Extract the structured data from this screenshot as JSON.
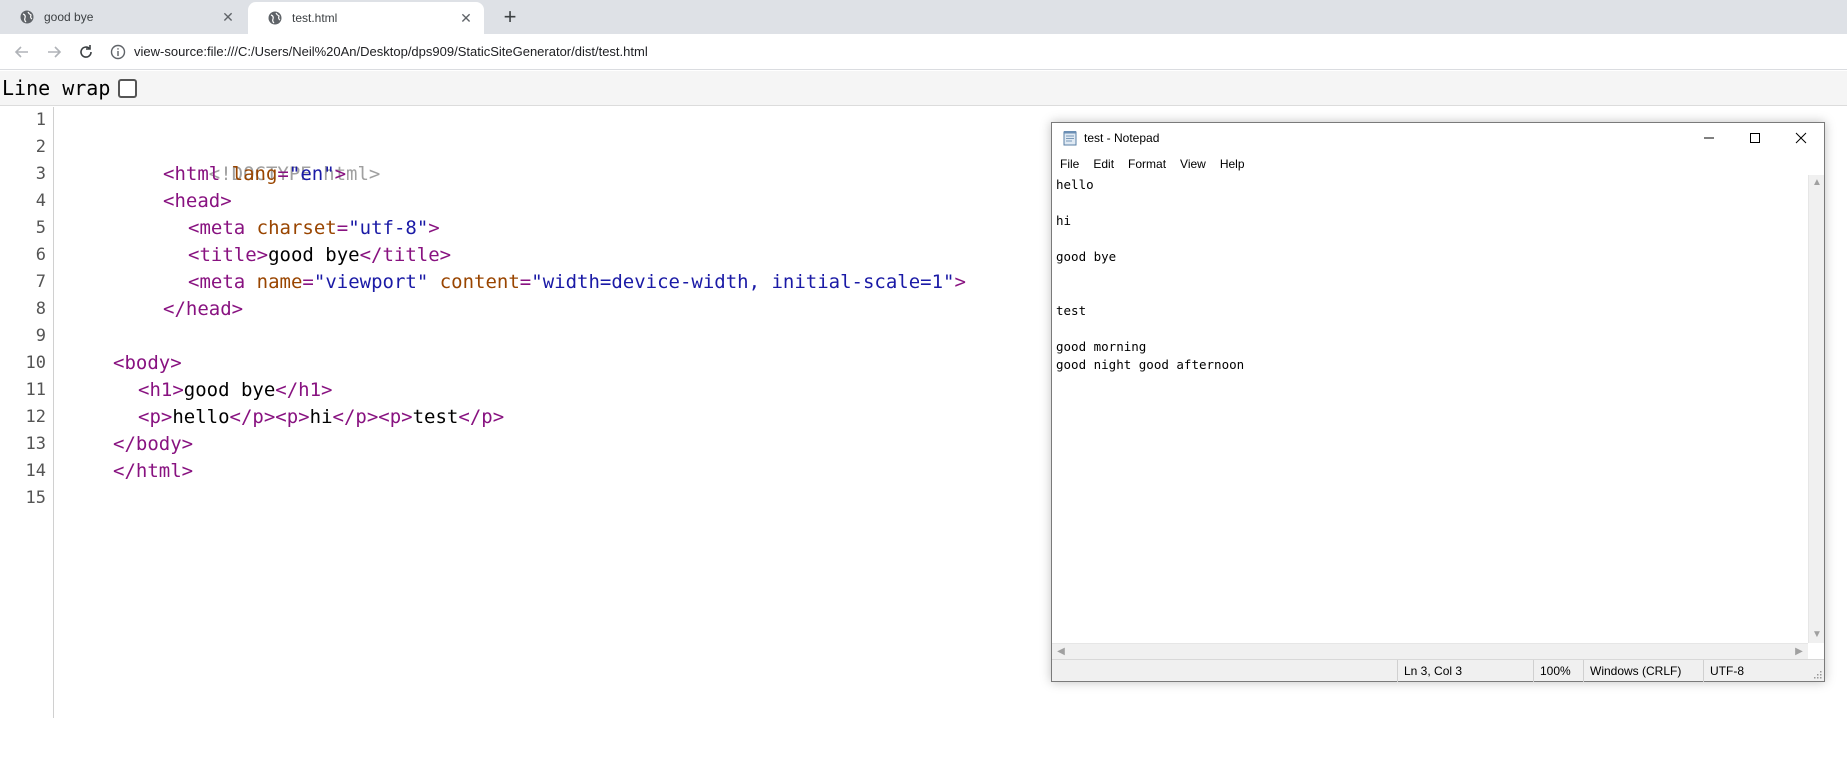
{
  "browser": {
    "tabs": [
      {
        "title": "good bye",
        "active": false
      },
      {
        "title": "test.html",
        "active": true
      }
    ],
    "address": "view-source:file:///C:/Users/Neil%20An/Desktop/dps909/StaticSiteGenerator/dist/test.html"
  },
  "view_source": {
    "line_wrap_label": "Line wrap",
    "line_wrap_checked": false,
    "line_numbers": [
      "1",
      "2",
      "3",
      "4",
      "5",
      "6",
      "7",
      "8",
      "9",
      "10",
      "11",
      "12",
      "13",
      "14",
      "15"
    ],
    "lines": {
      "l2": "<!DOCTYPE html>",
      "l3_open": "<html",
      "l3_attr": "lang",
      "l3_val": "\"en\"",
      "l3_close": ">",
      "l4": "<head>",
      "l5_open": "<meta",
      "l5_attr": "charset",
      "l5_val": "\"utf-8\"",
      "l5_close": ">",
      "l6_open": "<title>",
      "l6_text": "good bye",
      "l6_close": "</title>",
      "l7_open": "<meta",
      "l7_attr1": "name",
      "l7_val1": "\"viewport\"",
      "l7_attr2": "content",
      "l7_val2": "\"width=device-width, initial-scale=1\"",
      "l7_close": ">",
      "l8": "</head>",
      "l10": "<body>",
      "l11_open": "<h1>",
      "l11_text": "good bye",
      "l11_close": "</h1>",
      "l12_p1o": "<p>",
      "l12_t1": "hello",
      "l12_p1c": "</p>",
      "l12_p2o": "<p>",
      "l12_t2": "hi",
      "l12_p2c": "</p>",
      "l12_p3o": "<p>",
      "l12_t3": "test",
      "l12_p3c": "</p>",
      "l13": "</body>",
      "l14": "</html>"
    }
  },
  "notepad": {
    "title": "test - Notepad",
    "menu": [
      "File",
      "Edit",
      "Format",
      "View",
      "Help"
    ],
    "content": "hello\n\nhi\n\ngood bye\n\n\ntest\n\ngood morning\ngood night good afternoon",
    "status": {
      "position": "Ln 3, Col 3",
      "zoom": "100%",
      "line_ending": "Windows (CRLF)",
      "encoding": "UTF-8"
    }
  },
  "colors": {
    "tag": "#881280",
    "attr": "#994500",
    "value": "#1a1aa6",
    "doctype": "#a0a0a0"
  },
  "icons": [
    "globe-icon",
    "close-icon",
    "plus-icon",
    "back-arrow-icon",
    "forward-arrow-icon",
    "reload-icon",
    "info-icon",
    "notepad-icon",
    "minimize-icon",
    "maximize-icon"
  ]
}
